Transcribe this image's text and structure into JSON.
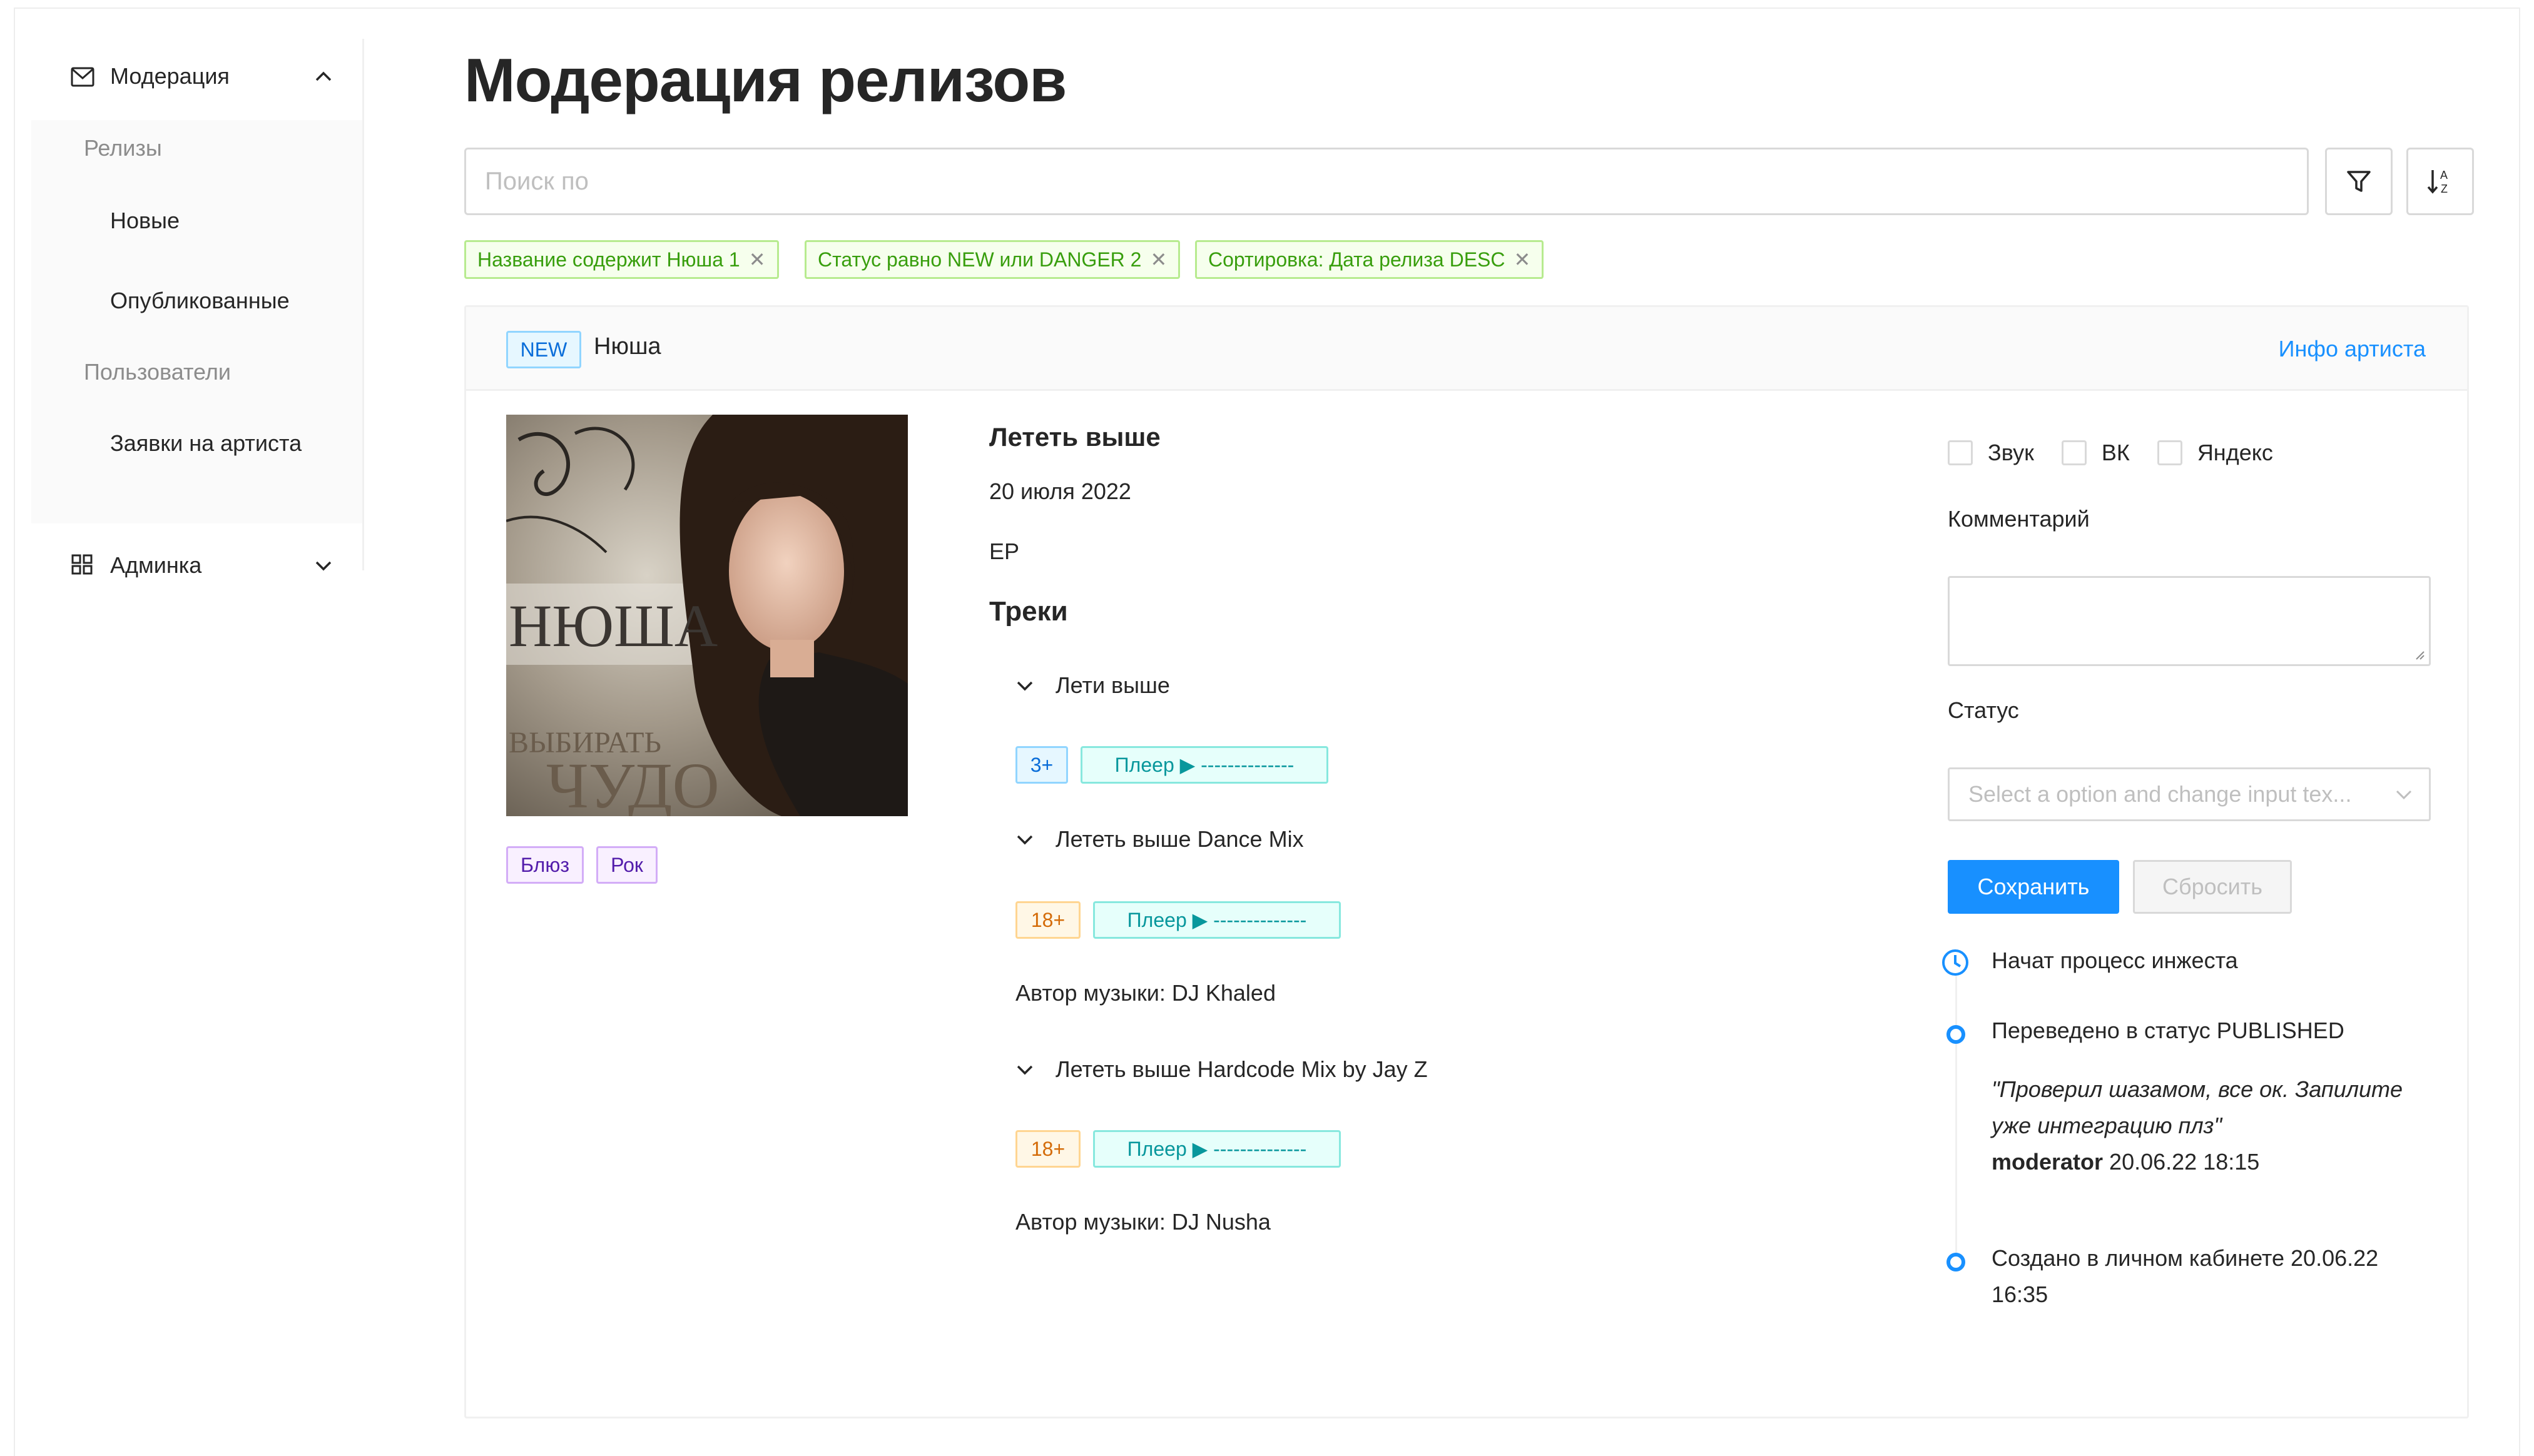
{
  "sidebar": {
    "moderation": "Модерация",
    "releases_group": "Релизы",
    "new": "Новые",
    "published": "Опубликованные",
    "users_group": "Пользователи",
    "artist_requests": "Заявки на артиста",
    "admin": "Админка"
  },
  "header": {
    "title": "Модерация релизов",
    "search_placeholder": "Поиск по"
  },
  "filters": [
    "Название содержит Нюша 1",
    "Статус равно NEW или DANGER 2",
    "Сортировка: Дата релиза DESC"
  ],
  "card": {
    "status_tag": "NEW",
    "artist": "Нюша",
    "artist_link": "Инфо артиста",
    "cover_text_top": "НЮША",
    "cover_text_mid": "ВЫБИРАТЬ",
    "cover_text_bottom": "ЧУДО",
    "genres": [
      "Блюз",
      "Рок"
    ],
    "release_title": "Лететь выше",
    "release_date": "20 июля 2022",
    "release_type": "EP",
    "tracks_title": "Треки",
    "tracks": [
      {
        "title": "Лети выше",
        "age": "3+",
        "player": "Плеер ▶ --------------"
      },
      {
        "title": "Лететь выше Dance Mix",
        "age": "18+",
        "player": "Плеер ▶ --------------",
        "author": "Автор музыки: DJ Khaled"
      },
      {
        "title": "Лететь выше Hardcode Mix by Jay Z",
        "age": "18+",
        "player": "Плеер ▶ --------------",
        "author": "Автор музыки: DJ Nusha"
      }
    ]
  },
  "moderation_panel": {
    "platforms": [
      "Звук",
      "ВК",
      "Яндекс"
    ],
    "comment_label": "Комментарий",
    "status_label": "Статус",
    "status_placeholder": "Select a option and change input tex...",
    "save": "Сохранить",
    "reset": "Сбросить"
  },
  "timeline": {
    "item1": "Начат процесс инжеста",
    "item2": "Переведено в статус PUBLISHED",
    "quote_line1": "\"Проверил шазамом, все ок. Запилите",
    "quote_line2": "уже интеграцию плз\"",
    "author": "moderator",
    "author_time": "20.06.22 18:15",
    "item3_line1": "Создано в личном кабинете 20.06.22",
    "item3_line2": "16:35"
  },
  "colors": {
    "primary": "#1890ff",
    "chip_green": "#389e0d",
    "tag_blue": "#096dd9",
    "tag_purple": "#531dab",
    "tag_orange": "#d46b08",
    "tag_cyan": "#08979c"
  }
}
